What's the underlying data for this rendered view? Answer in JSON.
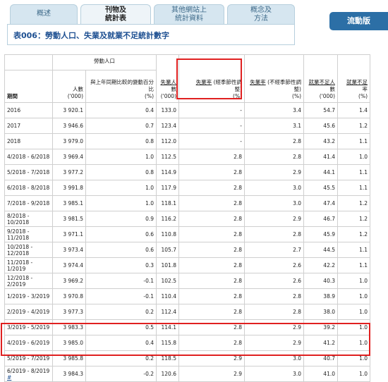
{
  "tabs": [
    {
      "label": "概述",
      "active": false
    },
    {
      "label": "刊物及\n統計表",
      "active": true
    },
    {
      "label": "其他網站上\n統計資料",
      "active": false
    },
    {
      "label": "概念及\n方法",
      "active": false
    }
  ],
  "mobile_button": "流動版",
  "table_title": "表006：勞動人口、失業及就業不足統計數字",
  "headers": {
    "labour_force_group": "勞動人口",
    "period": "期間",
    "persons": "人數\n('000)",
    "yoy_change": "與上年同期比較的變動百分比\n(%)",
    "unemployed": "失業人數\n('000)",
    "unemp_rate_sa": "失業率 (經季節性調整)\n(%)",
    "unemp_rate_nsa": "失業率 (不經季節性調整)\n(%)",
    "underemployed": "就業不足人數\n('000)",
    "underemp_rate": "就業不足率\n(%)"
  },
  "rows": [
    {
      "period": "2016",
      "persons": "3 920.1",
      "yoy": "0.4",
      "unemployed": "133.0",
      "sa": "-",
      "nsa": "3.4",
      "under": "54.7",
      "underrate": "1.4"
    },
    {
      "period": "2017",
      "persons": "3 946.6",
      "yoy": "0.7",
      "unemployed": "123.4",
      "sa": "-",
      "nsa": "3.1",
      "under": "45.6",
      "underrate": "1.2"
    },
    {
      "period": "2018",
      "persons": "3 979.0",
      "yoy": "0.8",
      "unemployed": "112.0",
      "sa": "-",
      "nsa": "2.8",
      "under": "43.2",
      "underrate": "1.1"
    },
    {
      "period": "4/2018 - 6/2018",
      "persons": "3 969.4",
      "yoy": "1.0",
      "unemployed": "112.5",
      "sa": "2.8",
      "nsa": "2.8",
      "under": "41.4",
      "underrate": "1.0"
    },
    {
      "period": "5/2018 - 7/2018",
      "persons": "3 977.2",
      "yoy": "0.8",
      "unemployed": "114.9",
      "sa": "2.8",
      "nsa": "2.9",
      "under": "44.1",
      "underrate": "1.1"
    },
    {
      "period": "6/2018 - 8/2018",
      "persons": "3 991.8",
      "yoy": "1.0",
      "unemployed": "117.9",
      "sa": "2.8",
      "nsa": "3.0",
      "under": "45.5",
      "underrate": "1.1"
    },
    {
      "period": "7/2018 - 9/2018",
      "persons": "3 985.1",
      "yoy": "1.0",
      "unemployed": "118.1",
      "sa": "2.8",
      "nsa": "3.0",
      "under": "47.4",
      "underrate": "1.2"
    },
    {
      "period": "8/2018 - 10/2018",
      "persons": "3 981.5",
      "yoy": "0.9",
      "unemployed": "116.2",
      "sa": "2.8",
      "nsa": "2.9",
      "under": "46.7",
      "underrate": "1.2"
    },
    {
      "period": "9/2018 - 11/2018",
      "persons": "3 971.1",
      "yoy": "0.6",
      "unemployed": "110.8",
      "sa": "2.8",
      "nsa": "2.8",
      "under": "45.9",
      "underrate": "1.2"
    },
    {
      "period": "10/2018 - 12/2018",
      "persons": "3 973.4",
      "yoy": "0.6",
      "unemployed": "105.7",
      "sa": "2.8",
      "nsa": "2.7",
      "under": "44.5",
      "underrate": "1.1"
    },
    {
      "period": "11/2018 - 1/2019",
      "persons": "3 974.4",
      "yoy": "0.3",
      "unemployed": "101.8",
      "sa": "2.8",
      "nsa": "2.6",
      "under": "42.2",
      "underrate": "1.1"
    },
    {
      "period": "12/2018 - 2/2019",
      "persons": "3 969.2",
      "yoy": "-0.1",
      "unemployed": "102.5",
      "sa": "2.8",
      "nsa": "2.6",
      "under": "40.3",
      "underrate": "1.0"
    },
    {
      "period": "1/2019 - 3/2019",
      "persons": "3 970.8",
      "yoy": "-0.1",
      "unemployed": "110.4",
      "sa": "2.8",
      "nsa": "2.8",
      "under": "38.9",
      "underrate": "1.0"
    },
    {
      "period": "2/2019 - 4/2019",
      "persons": "3 977.3",
      "yoy": "0.2",
      "unemployed": "112.4",
      "sa": "2.8",
      "nsa": "2.8",
      "under": "38.0",
      "underrate": "1.0"
    },
    {
      "period": "3/2019 - 5/2019",
      "persons": "3 983.3",
      "yoy": "0.5",
      "unemployed": "114.1",
      "sa": "2.8",
      "nsa": "2.9",
      "under": "39.2",
      "underrate": "1.0"
    },
    {
      "period": "4/2019 - 6/2019",
      "persons": "3 985.0",
      "yoy": "0.4",
      "unemployed": "115.8",
      "sa": "2.8",
      "nsa": "2.9",
      "under": "41.2",
      "underrate": "1.0"
    },
    {
      "period": "5/2019 - 7/2019",
      "persons": "3 985.8",
      "yoy": "0.2",
      "unemployed": "118.5",
      "sa": "2.9",
      "nsa": "3.0",
      "under": "40.7",
      "underrate": "1.0"
    },
    {
      "period": "6/2019 - 8/2019",
      "persons": "3 984.3",
      "yoy": "-0.2",
      "unemployed": "120.6",
      "sa": "2.9",
      "nsa": "3.0",
      "under": "41.0",
      "underrate": "1.0",
      "footnote": "#"
    }
  ],
  "colors": {
    "tab_bg": "#d6e6f0",
    "title_text": "#1d4f91",
    "mobile_button": "#2c6fa6",
    "highlight": "#e02020"
  }
}
